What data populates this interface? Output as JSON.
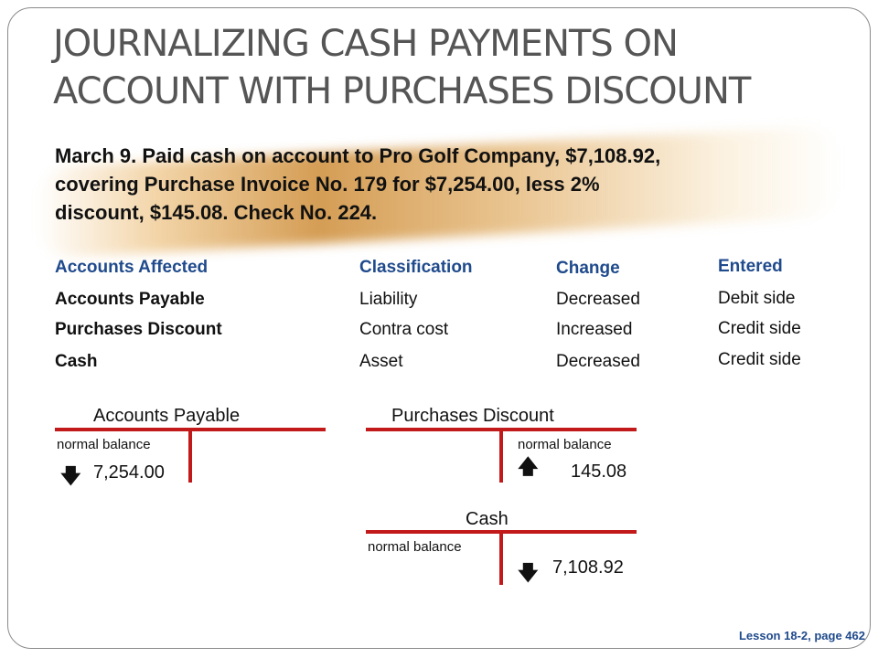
{
  "title": {
    "line1": "JOURNALIZING CASH PAYMENTS ON",
    "line2": "ACCOUNT WITH  PURCHASES DISCOUNT"
  },
  "transaction": {
    "line1": "March 9. Paid cash on account to Pro Golf Company, $7,108.92,",
    "line2": "covering Purchase Invoice No. 179 for $7,254.00, less 2%",
    "line3": "discount, $145.08. Check No. 224."
  },
  "analysis": {
    "headers": {
      "accounts": "Accounts Affected",
      "classification": "Classification",
      "change": "Change",
      "entered": "Entered"
    },
    "rows": [
      {
        "account": "Accounts Payable",
        "classification": "Liability",
        "change": "Decreased",
        "entered": "Debit side"
      },
      {
        "account": "Purchases Discount",
        "classification": "Contra cost",
        "change": "Increased",
        "entered": "Credit side"
      },
      {
        "account": "Cash",
        "classification": "Asset",
        "change": "Decreased",
        "entered": "Credit side"
      }
    ]
  },
  "t_accounts": {
    "accounts_payable": {
      "name": "Accounts Payable",
      "normal_balance": "normal balance",
      "amount": "7,254.00",
      "arrow": "down-arrow"
    },
    "purchases_discount": {
      "name": "Purchases Discount",
      "normal_balance": "normal balance",
      "amount": "145.08",
      "arrow": "up-arrow"
    },
    "cash": {
      "name": "Cash",
      "normal_balance": "normal balance",
      "amount": "7,108.92",
      "arrow": "down-arrow"
    }
  },
  "footer": "Lesson 18-2, page 462",
  "colors": {
    "header_blue": "#1f4a8c",
    "t_line_red": "#c21a1a",
    "title_gray": "#555555"
  }
}
